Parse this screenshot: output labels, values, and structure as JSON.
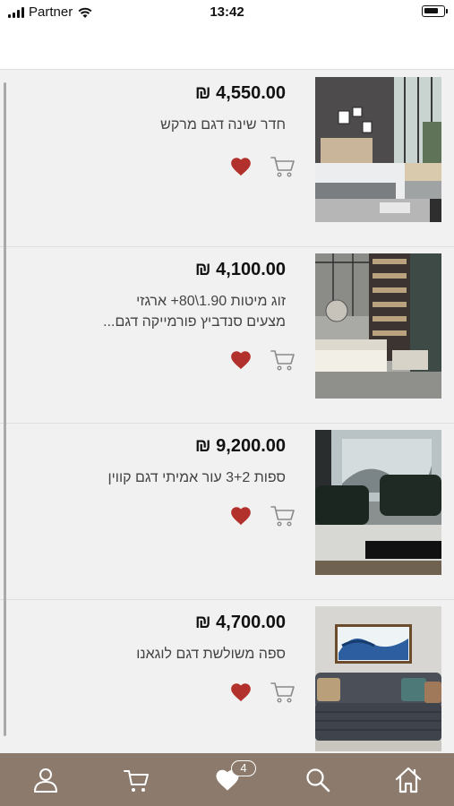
{
  "status_bar": {
    "carrier": "Partner",
    "time": "13:42"
  },
  "products": [
    {
      "price": "₪ 4,550.00",
      "title": "חדר שינה דגם מרקש",
      "image": "bedroom-marrakesh-photo"
    },
    {
      "price": "₪ 4,100.00",
      "title": "זוג מיטות 1.90\\80+ ארגזי מצעים סנדביץ פורמייקה דגם...",
      "image": "twin-beds-photo"
    },
    {
      "price": "₪ 9,200.00",
      "title": "ספות 3+2 עור אמיתי דגם קווין",
      "image": "leather-sofa-queen-photo"
    },
    {
      "price": "₪ 4,700.00",
      "title": "ספה משולשת דגם לוגאנו",
      "image": "three-seat-sofa-lugano-photo"
    }
  ],
  "bottom_nav": {
    "items": [
      "profile-icon",
      "cart-icon",
      "favorites-icon",
      "search-icon",
      "home-icon"
    ],
    "favorites_badge": "4"
  },
  "colors": {
    "nav_bg": "#8c7b6c",
    "heart": "#b3312c",
    "list_bg": "#f1f1f1"
  }
}
